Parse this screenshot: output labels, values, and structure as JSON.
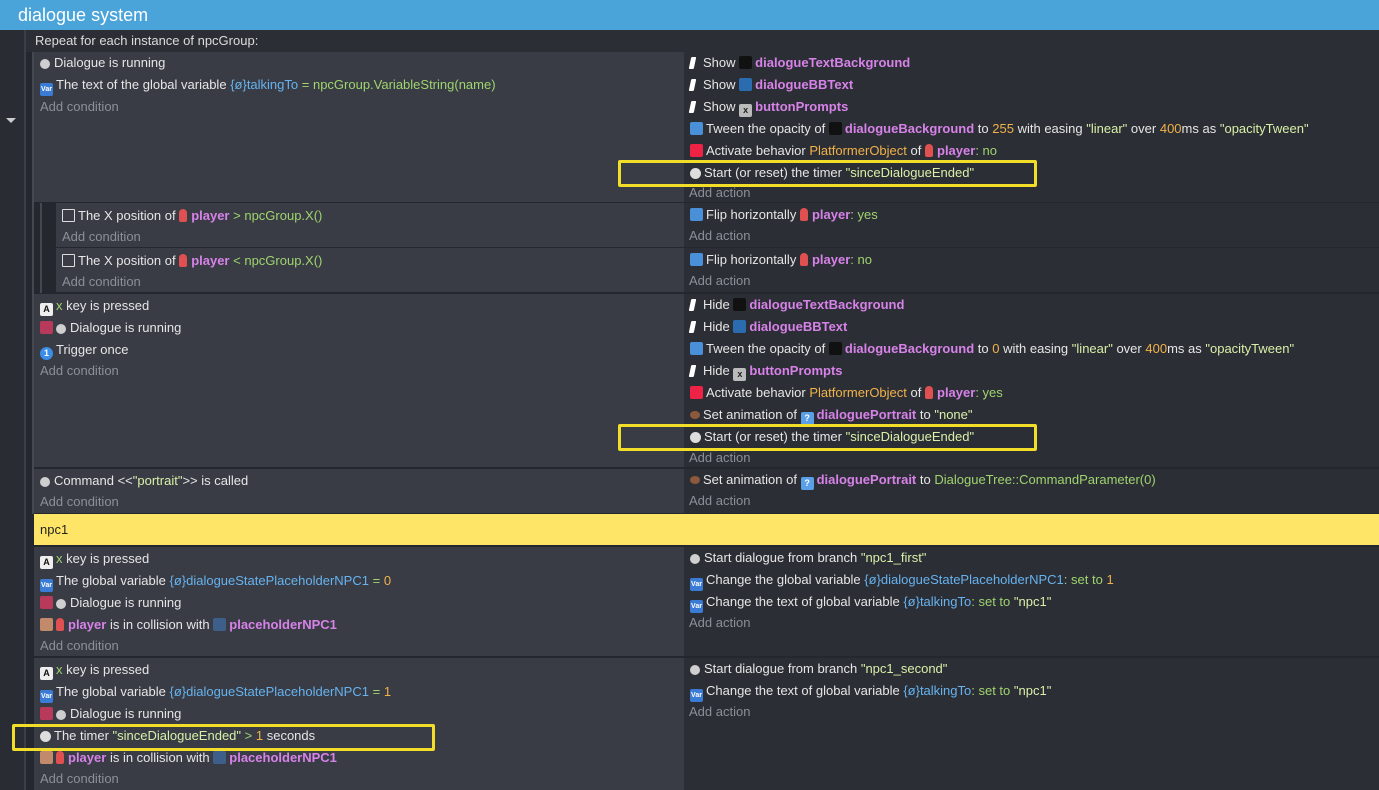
{
  "header": {
    "title": "dialogue system"
  },
  "repeat_label": "Repeat for each instance of npcGroup:",
  "add_condition": "Add condition",
  "add_action": "Add action",
  "e1": {
    "c1": "Dialogue is running",
    "c2_a": "The text of the global variable",
    "c2_var": "talkingTo",
    "c2_op": "=",
    "c2_val": "npcGroup.VariableString(name)",
    "a_show": "Show",
    "a1_obj": "dialogueTextBackground",
    "a2_obj": "dialogueBBText",
    "a3_obj": "buttonPrompts",
    "a4_a": "Tween the opacity of",
    "a4_obj": "dialogueBackground",
    "a4_to": "to",
    "a4_val": "255",
    "a4_ease": "with easing",
    "a4_easev": "\"linear\"",
    "a4_over": "over",
    "a4_ms": "400",
    "a4_ms2": "ms as",
    "a4_name": "\"opacityTween\"",
    "a5_a": "Activate behavior",
    "a5_beh": "PlatformerObject",
    "a5_of": "of",
    "a5_obj": "player",
    "a5_val": ": no",
    "a6_a": "Start (or reset) the timer",
    "a6_name": "\"sinceDialogueEnded\""
  },
  "e2": {
    "c1_a": "The X position of",
    "c1_obj": "player",
    "c1_op": ">",
    "c1_val": "npcGroup.X()",
    "a1_a": "Flip horizontally",
    "a1_obj": "player",
    "a1_val": ": yes"
  },
  "e3": {
    "c1_op": "<",
    "a1_val": ": no"
  },
  "e4": {
    "c1_key": "x",
    "c1_a": "key is pressed",
    "c2": "Dialogue is running",
    "c3": "Trigger once",
    "a_hide": "Hide",
    "a4_val": "0",
    "a5_val": ": yes",
    "a6_a": "Set animation of",
    "a6_obj": "dialoguePortrait",
    "a6_to": "to",
    "a6_val": "\"none\""
  },
  "e5": {
    "c1_a": "Command <<",
    "c1_str": "\"portrait\"",
    "c1_b": ">> is called",
    "a1_val": "DialogueTree::CommandParameter(0)"
  },
  "npc1_label": "npc1",
  "e6": {
    "c2_a": "The global variable",
    "c2_var": "dialogueStatePlaceholderNPC1",
    "c2_op": "=",
    "c2_val": "0",
    "c4_a": "is in collision with",
    "c4_obj": "placeholderNPC1",
    "a1_a": "Start dialogue from branch",
    "a1_val": "\"npc1_first\"",
    "a2_a": "Change the global variable",
    "a2_var": "dialogueStatePlaceholderNPC1",
    "a2_set": ": set to",
    "a2_val": "1",
    "a3_a": "Change the text of global variable",
    "a3_var": "talkingTo",
    "a3_set": ": set to",
    "a3_val": "\"npc1\""
  },
  "e7": {
    "c2_val": "1",
    "c4_a": "The timer",
    "c4_name": "\"sinceDialogueEnded\"",
    "c4_op": ">",
    "c4_val": "1",
    "c4_unit": "seconds",
    "a1_val": "\"npc1_second\""
  }
}
